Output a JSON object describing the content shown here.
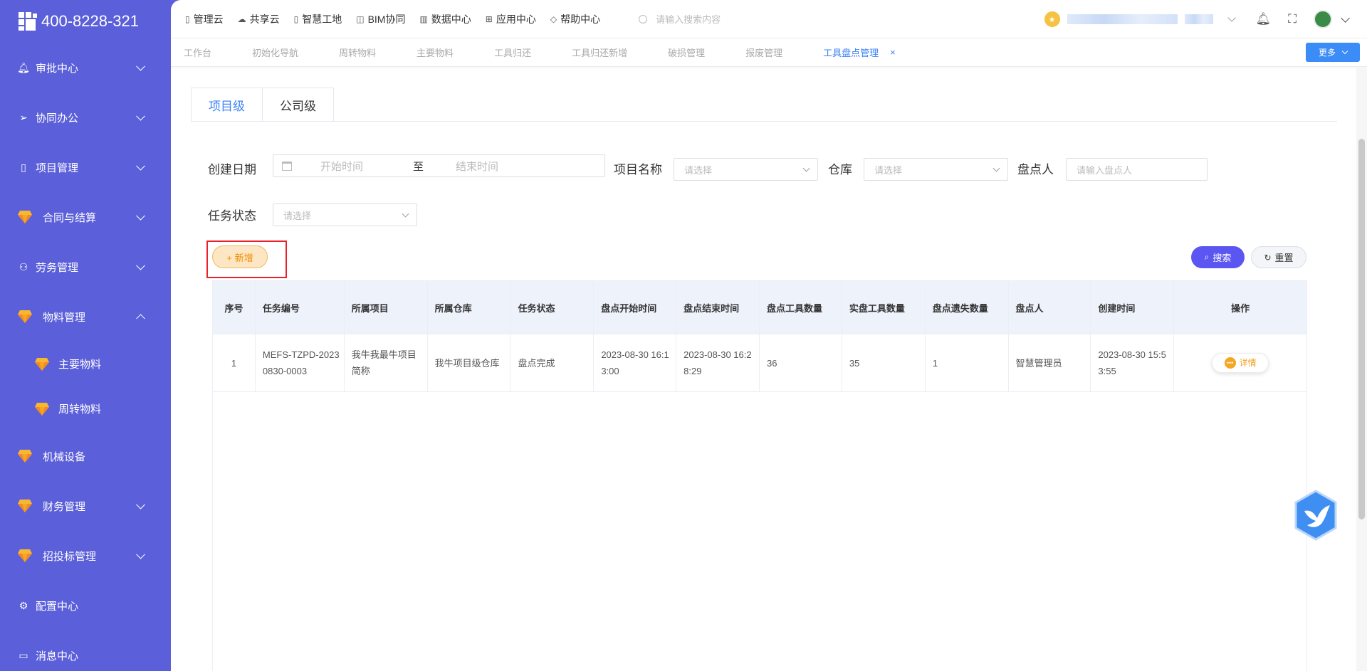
{
  "sidebar": {
    "phone": "400-8228-321",
    "items": [
      {
        "label": "审批中心",
        "icon": "bell-icon",
        "expandable": true
      },
      {
        "label": "协同办公",
        "icon": "send-icon",
        "expandable": true
      },
      {
        "label": "项目管理",
        "icon": "book-icon",
        "expandable": true
      },
      {
        "label": "合同与结算",
        "icon": "gem-icon",
        "expandable": true
      },
      {
        "label": "劳务管理",
        "icon": "user-icon",
        "expandable": true
      },
      {
        "label": "物料管理",
        "icon": "gem-icon",
        "expandable": true,
        "expanded": true
      },
      {
        "label": "机械设备",
        "icon": "gem-icon",
        "expandable": false
      },
      {
        "label": "财务管理",
        "icon": "gem-icon",
        "expandable": true
      },
      {
        "label": "招投标管理",
        "icon": "gem-icon",
        "expandable": true
      },
      {
        "label": "配置中心",
        "icon": "gear-icon",
        "expandable": false
      },
      {
        "label": "消息中心",
        "icon": "message-icon",
        "expandable": false
      }
    ],
    "sub_items": [
      {
        "label": "主要物料",
        "icon": "gem-icon"
      },
      {
        "label": "周转物料",
        "icon": "gem-icon"
      }
    ]
  },
  "topnav": {
    "items": [
      {
        "label": "管理云",
        "icon": "doc-icon"
      },
      {
        "label": "共享云",
        "icon": "cloud-icon"
      },
      {
        "label": "智慧工地",
        "icon": "book-icon"
      },
      {
        "label": "BIM协同",
        "icon": "cube-icon"
      },
      {
        "label": "数据中心",
        "icon": "chart-icon"
      },
      {
        "label": "应用中心",
        "icon": "grid-icon"
      },
      {
        "label": "帮助中心",
        "icon": "diamond-icon"
      }
    ],
    "search_placeholder": "请输入搜索内容"
  },
  "tabs": {
    "items": [
      "工作台",
      "初始化导航",
      "周转物料",
      "主要物料",
      "工具归还",
      "工具归还新增",
      "破损管理",
      "报废管理",
      "工具盘点管理"
    ],
    "active": "工具盘点管理",
    "close": "×",
    "more_label": "更多"
  },
  "subtabs": {
    "project": "项目级",
    "company": "公司级"
  },
  "filters": {
    "create_date_label": "创建日期",
    "start_placeholder": "开始时间",
    "to_label": "至",
    "end_placeholder": "结束时间",
    "project_name_label": "项目名称",
    "project_name_placeholder": "请选择",
    "warehouse_label": "仓库",
    "warehouse_placeholder": "请选择",
    "checker_label": "盘点人",
    "checker_placeholder": "请输入盘点人",
    "task_status_label": "任务状态",
    "task_status_placeholder": "请选择"
  },
  "buttons": {
    "add": "+ 新增",
    "search": "搜索",
    "reset": "重置",
    "detail": "详情"
  },
  "table": {
    "columns": [
      "序号",
      "任务编号",
      "所属项目",
      "所属仓库",
      "任务状态",
      "盘点开始时间",
      "盘点结束时间",
      "盘点工具数量",
      "实盘工具数量",
      "盘点遗失数量",
      "盘点人",
      "创建时间",
      "操作"
    ],
    "rows": [
      [
        "1",
        "MEFS-TZPD-20230830-0003",
        "我牛我最牛项目简称",
        "我牛项目级仓库",
        "盘点完成",
        "2023-08-30 16:13:00",
        "2023-08-30 16:28:29",
        "36",
        "35",
        "1",
        "智慧管理员",
        "2023-08-30 15:53:55"
      ]
    ]
  },
  "colors": {
    "sidebar": "#5b5fd9",
    "accent": "#3b82f6",
    "search_button": "#5b55f2",
    "add_button": "#fde6c4"
  }
}
